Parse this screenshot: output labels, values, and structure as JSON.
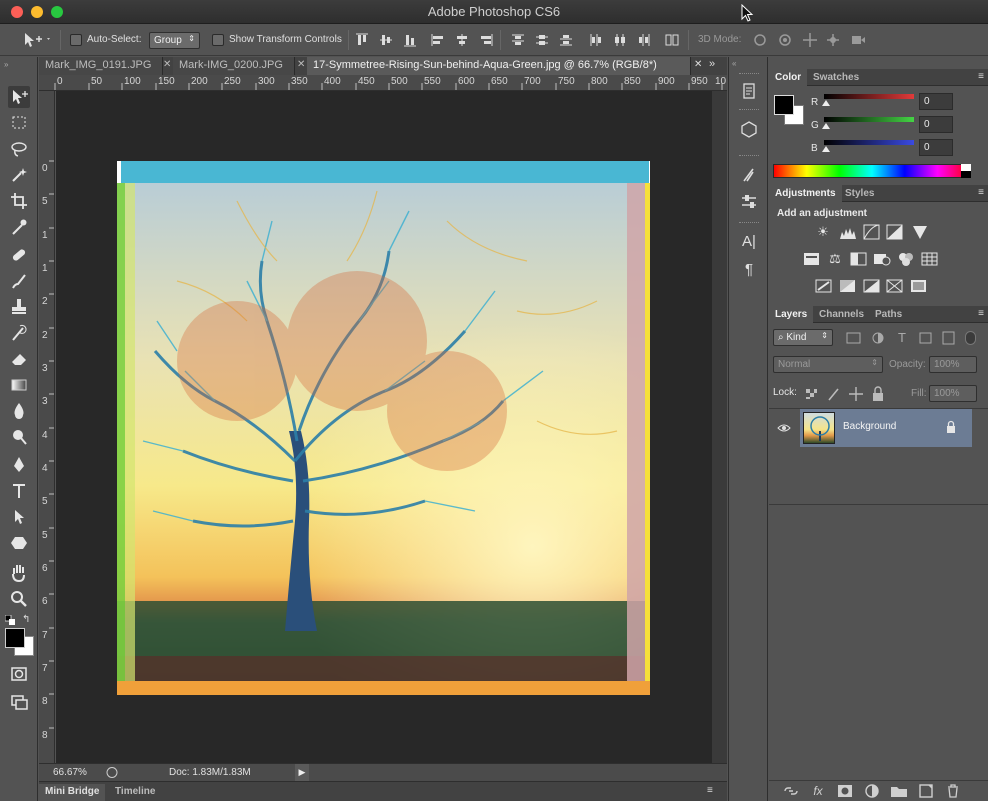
{
  "window": {
    "title": "Adobe Photoshop CS6"
  },
  "options_bar": {
    "auto_select_label": "Auto-Select:",
    "auto_select_value": "Group",
    "show_transform_label": "Show Transform Controls",
    "mode_3d_label": "3D Mode:"
  },
  "tabs": [
    {
      "label": "Mark_IMG_0191.JPG",
      "active": false
    },
    {
      "label": "Mark-IMG_0200.JPG",
      "active": false
    },
    {
      "label": "17-Symmetree-Rising-Sun-behind-Aqua-Green.jpg @ 66.7% (RGB/8*)",
      "active": true
    }
  ],
  "ruler": {
    "h_ticks": [
      "0",
      "50",
      "100",
      "150",
      "200",
      "250",
      "300",
      "350",
      "400",
      "450",
      "500",
      "550",
      "600",
      "650",
      "700",
      "750",
      "800",
      "850",
      "900",
      "950",
      "10"
    ],
    "v_ticks": [
      "0",
      "5",
      "1",
      "1",
      "2",
      "2",
      "3",
      "3",
      "4",
      "4",
      "5",
      "5",
      "6",
      "6",
      "7",
      "7",
      "8",
      "8"
    ]
  },
  "status": {
    "zoom": "66.67%",
    "doc": "Doc: 1.83M/1.83M"
  },
  "bottom_tabs": [
    "Mini Bridge",
    "Timeline"
  ],
  "color_panel": {
    "tabs": [
      "Color",
      "Swatches"
    ],
    "channels": [
      {
        "label": "R",
        "value": "0",
        "color": "#e23a3a"
      },
      {
        "label": "G",
        "value": "0",
        "color": "#44d444"
      },
      {
        "label": "B",
        "value": "0",
        "color": "#3a4ae2"
      }
    ]
  },
  "adjustments_panel": {
    "tabs": [
      "Adjustments",
      "Styles"
    ],
    "heading": "Add an adjustment"
  },
  "layers_panel": {
    "tabs": [
      "Layers",
      "Channels",
      "Paths"
    ],
    "kind_label": "Kind",
    "blend_mode": "Normal",
    "opacity_label": "Opacity:",
    "opacity_value": "100%",
    "lock_label": "Lock:",
    "fill_label": "Fill:",
    "fill_value": "100%",
    "layers": [
      {
        "name": "Background",
        "locked": true,
        "visible": true,
        "selected": true
      }
    ]
  },
  "colors": {
    "selected_layer": "#6c7c94",
    "canvas_bg": "#282828",
    "panel_bg": "#535353"
  }
}
